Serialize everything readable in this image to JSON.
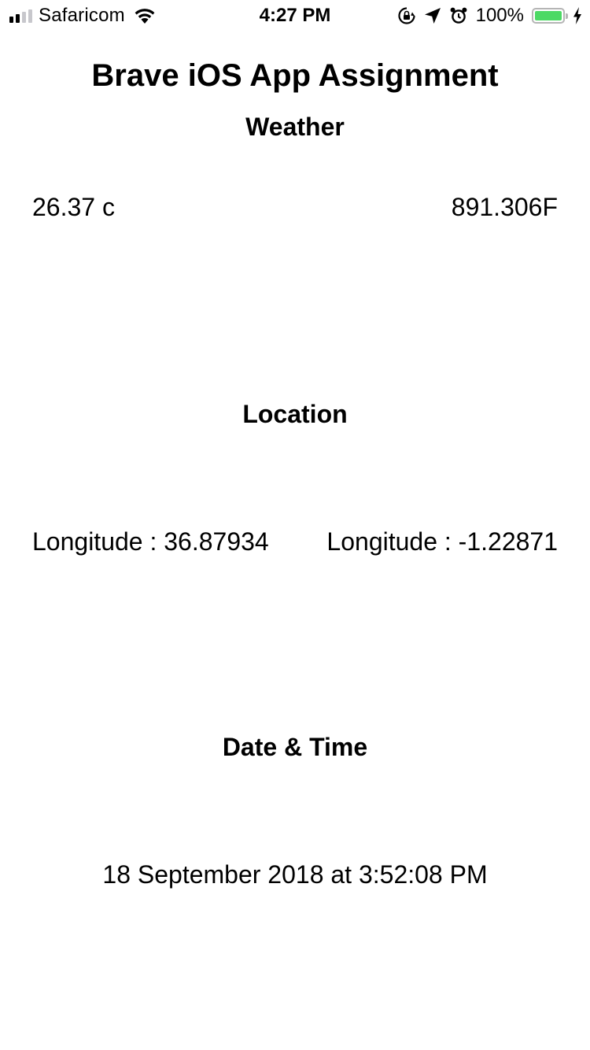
{
  "status_bar": {
    "carrier": "Safaricom",
    "time": "4:27 PM",
    "battery_percent": "100%",
    "battery_level": 1.0,
    "signal_bars": 2,
    "signal_total": 4,
    "icons": [
      "wifi-icon",
      "orientation-lock-icon",
      "location-arrow-icon",
      "alarm-icon",
      "battery-icon",
      "charging-bolt-icon"
    ],
    "colors": {
      "battery_green": "#4cd964",
      "signal_active": "#000000",
      "signal_inactive": "#c7c7cc"
    }
  },
  "header": {
    "title": "Brave iOS App Assignment"
  },
  "weather": {
    "heading": "Weather",
    "celsius": "26.37 c",
    "fahrenheit": "891.306F"
  },
  "location": {
    "heading": "Location",
    "first": "Longitude : 36.87934",
    "second": "Longitude : -1.22871"
  },
  "datetime": {
    "heading": "Date & Time",
    "value": "18 September 2018 at 3:52:08 PM"
  }
}
